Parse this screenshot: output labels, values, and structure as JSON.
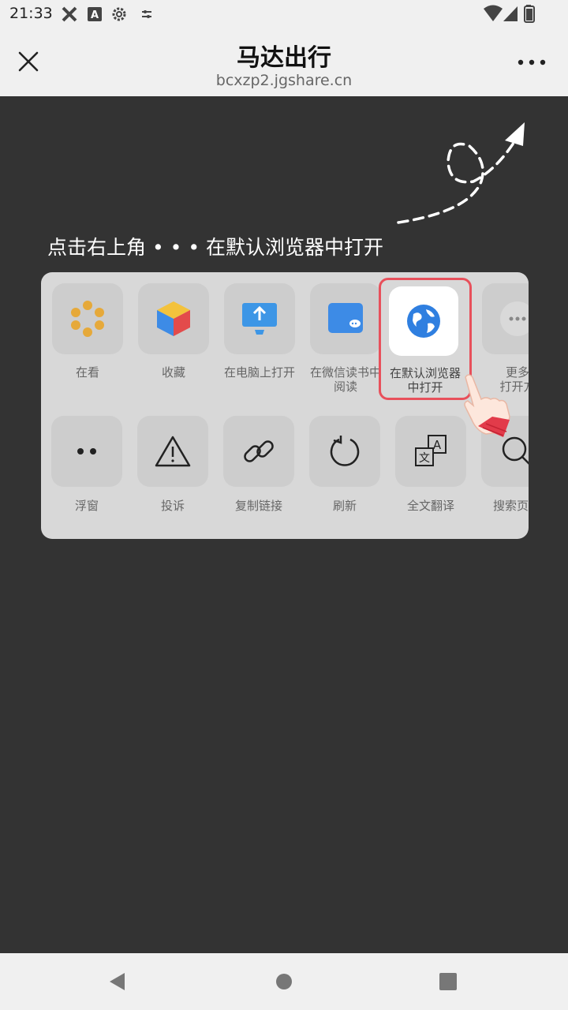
{
  "status_bar": {
    "time": "21:33",
    "left_icons": [
      "tools-icon",
      "a-badge-icon",
      "gear-icon",
      "tune-icon"
    ],
    "right_icons": [
      "wifi-icon",
      "signal-icon",
      "battery-icon"
    ]
  },
  "title_bar": {
    "title": "马达出行",
    "url": "bcxzp2.jgshare.cn",
    "close_icon": "close-icon",
    "more_icon": "more-dots-icon"
  },
  "hint": {
    "text": "点击右上角 • • • 在默认浏览器中打开"
  },
  "menu": {
    "row1": [
      {
        "label": "在看",
        "icon": "star-flower-icon"
      },
      {
        "label": "收藏",
        "icon": "cube-icon"
      },
      {
        "label": "在电脑上打开",
        "icon": "monitor-upload-icon"
      },
      {
        "label": "在微信读书中\n阅读",
        "icon": "wechat-read-icon"
      },
      {
        "label": "在默认浏览器\n中打开",
        "icon": "globe-icon",
        "highlighted": true
      },
      {
        "label": "更多\n打开方",
        "icon": "more-icon"
      }
    ],
    "row2": [
      {
        "label": "浮窗",
        "icon": "float-window-icon"
      },
      {
        "label": "投诉",
        "icon": "warning-icon"
      },
      {
        "label": "复制链接",
        "icon": "link-icon"
      },
      {
        "label": "刷新",
        "icon": "refresh-icon"
      },
      {
        "label": "全文翻译",
        "icon": "translate-icon"
      },
      {
        "label": "搜索页面",
        "icon": "search-icon"
      }
    ]
  },
  "nav_bar": {
    "back_icon": "back-triangle-icon",
    "home_icon": "home-circle-icon",
    "recents_icon": "recents-square-icon"
  },
  "colors": {
    "overlay": "#333333",
    "bar_bg": "#f0f0f0",
    "highlight": "#e8505b",
    "accent_blue": "#2f7fe0"
  }
}
